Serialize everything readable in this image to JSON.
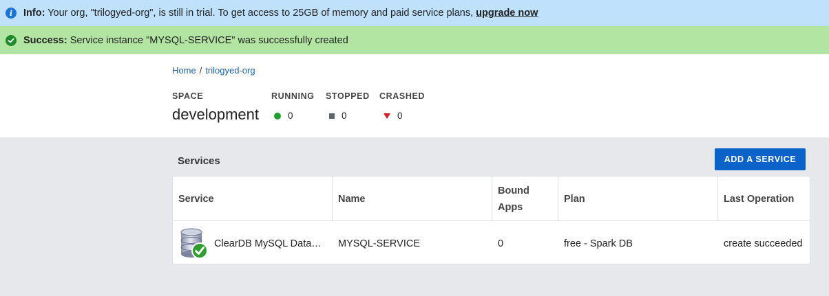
{
  "banners": {
    "info": {
      "label": "Info:",
      "text": " Your org, \"trilogyed-org\", is still in trial. To get access to 25GB of memory and paid service plans, ",
      "link": "upgrade now",
      "icon": "info-icon",
      "color": "#bfe1fb"
    },
    "success": {
      "label": "Success:",
      "text": " Service instance \"MYSQL-SERVICE\" was successfully created",
      "icon": "check-circle-icon",
      "color": "#b2e4a2"
    }
  },
  "breadcrumb": {
    "home": "Home",
    "separator": "/",
    "org": "trilogyed-org"
  },
  "space": {
    "label": "SPACE",
    "name": "development"
  },
  "stats": {
    "running": {
      "label": "RUNNING",
      "value": "0",
      "color": "#1e9e2e"
    },
    "stopped": {
      "label": "STOPPED",
      "value": "0",
      "color": "#5d6770"
    },
    "crashed": {
      "label": "CRASHED",
      "value": "0",
      "color": "#d81e1e"
    }
  },
  "services": {
    "title": "Services",
    "add_button": "ADD A SERVICE",
    "columns": {
      "service": "Service",
      "name": "Name",
      "bound_apps_1": "Bound",
      "bound_apps_2": "Apps",
      "plan": "Plan",
      "last_operation": "Last Operation"
    },
    "rows": [
      {
        "service": "ClearDB MySQL Data…",
        "service_icon": "database-check-icon",
        "name": "MYSQL-SERVICE",
        "bound_apps": "0",
        "plan": "free - Spark DB",
        "last_operation": "create succeeded"
      }
    ]
  },
  "colors": {
    "accent": "#0b62c8",
    "link": "#1b5fb5",
    "content_bg": "#e6e8eb"
  }
}
